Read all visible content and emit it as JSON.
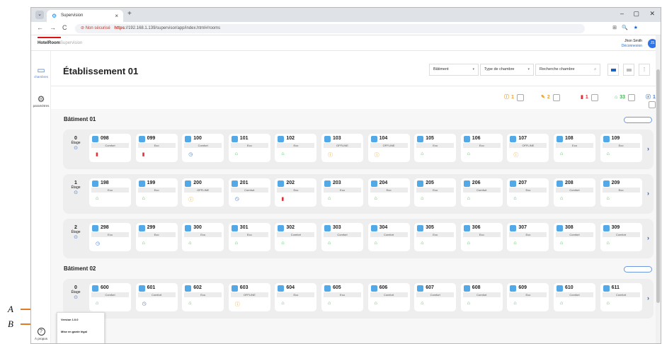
{
  "browser": {
    "tab_title": "Supervision",
    "tab_close": "×",
    "new_tab": "+",
    "menu_glyph": "⌄",
    "window_controls": [
      "–",
      "▢",
      "✕"
    ],
    "nav": {
      "back": "←",
      "forward": "→",
      "reload": "C"
    },
    "url_warning": "Non sécurisé",
    "url_scheme": "https",
    "url_rest": "://192.168.1.139/supervisor/app/index.html#/rooms",
    "right_icons": [
      "⊞",
      "🔍",
      "★"
    ]
  },
  "app": {
    "brand_main": "HotelRoom",
    "brand_sub": "Supervision",
    "user_name": "Jhon Smith",
    "logout": "Déconnexion",
    "avatar": "JS"
  },
  "sidebar": [
    {
      "label": "chambres",
      "icon": "bed-icon",
      "glyph": "▭"
    },
    {
      "label": "paramètres",
      "icon": "gear-icon",
      "glyph": "⚙"
    },
    {
      "label": "À propos",
      "icon": "question-icon",
      "glyph": "?"
    }
  ],
  "main": {
    "title": "Établissement 01",
    "filters": {
      "building": "Bâtiment",
      "room_type": "Type de chambre",
      "search": "Recherche chambre",
      "caret": "▾",
      "search_icon": "⌕"
    },
    "view_more": "⋮",
    "stats": [
      {
        "glyph": "ⓘ",
        "value": "1",
        "color": "#f0a020",
        "icon": "alert-icon"
      },
      {
        "glyph": "✎",
        "value": "2",
        "color": "#f0a020",
        "icon": "wrench-icon"
      },
      {
        "glyph": "▮",
        "value": "1",
        "color": "#e0303a",
        "icon": "battery-icon"
      },
      {
        "glyph": "⌂",
        "value": "33",
        "color": "#3fb34f",
        "icon": "signal-icon"
      },
      {
        "glyph": "ⓧ",
        "value": "1",
        "color": "#4a7fd4",
        "icon": "clock-icon"
      }
    ]
  },
  "floor_label": "Étage",
  "buildings": [
    {
      "name": "Bâtiment 01",
      "floors": [
        {
          "num": "0",
          "rooms": [
            {
              "n": "098",
              "m": "Comfort",
              "s": "bat"
            },
            {
              "n": "099",
              "m": "Eco",
              "s": "bat"
            },
            {
              "n": "100",
              "m": "Comfort",
              "s": "clock"
            },
            {
              "n": "101",
              "m": "Eco",
              "s": "ok"
            },
            {
              "n": "102",
              "m": "Eco",
              "s": "ok"
            },
            {
              "n": "103",
              "m": "OFFLINE",
              "s": "warn"
            },
            {
              "n": "104",
              "m": "OFFLINE",
              "s": "warn"
            },
            {
              "n": "105",
              "m": "Eco",
              "s": "ok"
            },
            {
              "n": "106",
              "m": "Eco",
              "s": "ok"
            },
            {
              "n": "107",
              "m": "OFFLINE",
              "s": "warn"
            },
            {
              "n": "108",
              "m": "Eco",
              "s": "ok"
            },
            {
              "n": "109",
              "m": "Eco",
              "s": "ok"
            }
          ]
        },
        {
          "num": "1",
          "rooms": [
            {
              "n": "198",
              "m": "Eco",
              "s": "ok"
            },
            {
              "n": "199",
              "m": "Eco",
              "s": "ok"
            },
            {
              "n": "200",
              "m": "OFFLINE",
              "s": "warn"
            },
            {
              "n": "201",
              "m": "Comfort",
              "s": "clock"
            },
            {
              "n": "202",
              "m": "Eco",
              "s": "bat"
            },
            {
              "n": "203",
              "m": "Eco",
              "s": "ok"
            },
            {
              "n": "204",
              "m": "Eco",
              "s": "ok"
            },
            {
              "n": "205",
              "m": "Eco",
              "s": "ok"
            },
            {
              "n": "206",
              "m": "Comfort",
              "s": "ok"
            },
            {
              "n": "207",
              "m": "Eco",
              "s": "ok"
            },
            {
              "n": "208",
              "m": "Comfort",
              "s": "ok"
            },
            {
              "n": "209",
              "m": "Eco",
              "s": "ok"
            }
          ]
        },
        {
          "num": "2",
          "rooms": [
            {
              "n": "298",
              "m": "Eco",
              "s": "clock"
            },
            {
              "n": "299",
              "m": "Eco",
              "s": "ok"
            },
            {
              "n": "300",
              "m": "Eco",
              "s": "ok"
            },
            {
              "n": "301",
              "m": "Eco",
              "s": "ok"
            },
            {
              "n": "302",
              "m": "Comfort",
              "s": "ok"
            },
            {
              "n": "303",
              "m": "Comfort",
              "s": "ok"
            },
            {
              "n": "304",
              "m": "Comfort",
              "s": "ok"
            },
            {
              "n": "305",
              "m": "Eco",
              "s": "ok"
            },
            {
              "n": "306",
              "m": "Eco",
              "s": "ok"
            },
            {
              "n": "307",
              "m": "Eco",
              "s": "ok"
            },
            {
              "n": "308",
              "m": "Comfort",
              "s": "ok"
            },
            {
              "n": "309",
              "m": "Comfort",
              "s": "ok"
            }
          ]
        }
      ]
    },
    {
      "name": "Bâtiment 02",
      "floors": [
        {
          "num": "0",
          "rooms": [
            {
              "n": "600",
              "m": "Comfort",
              "s": "ok"
            },
            {
              "n": "601",
              "m": "Comfort",
              "s": "clock"
            },
            {
              "n": "602",
              "m": "Eco",
              "s": "ok"
            },
            {
              "n": "603",
              "m": "OFFLINE",
              "s": "warn"
            },
            {
              "n": "604",
              "m": "Eco",
              "s": "ok"
            },
            {
              "n": "605",
              "m": "Eco",
              "s": "ok"
            },
            {
              "n": "606",
              "m": "Comfort",
              "s": "ok"
            },
            {
              "n": "607",
              "m": "Comfort",
              "s": "ok"
            },
            {
              "n": "608",
              "m": "Comfort",
              "s": "ok"
            },
            {
              "n": "609",
              "m": "Eco",
              "s": "ok"
            },
            {
              "n": "610",
              "m": "Comfort",
              "s": "ok"
            },
            {
              "n": "611",
              "m": "Comfort",
              "s": "ok"
            }
          ]
        }
      ]
    }
  ],
  "status_glyphs": {
    "ok": {
      "g": "⌂",
      "c": "#3fb34f",
      "icon": "signal-icon"
    },
    "bat": {
      "g": "▮",
      "c": "#e0303a",
      "icon": "battery-icon"
    },
    "clock": {
      "g": "◷",
      "c": "#4a7fd4",
      "icon": "clock-icon"
    },
    "warn": {
      "g": "ⓘ",
      "c": "#f0a020",
      "icon": "alert-icon"
    }
  },
  "next_arrow": "›",
  "popup": {
    "version": "Version 1.0.0",
    "legal": "Mise en garde légal"
  },
  "callouts": {
    "a": "A",
    "b": "B"
  }
}
